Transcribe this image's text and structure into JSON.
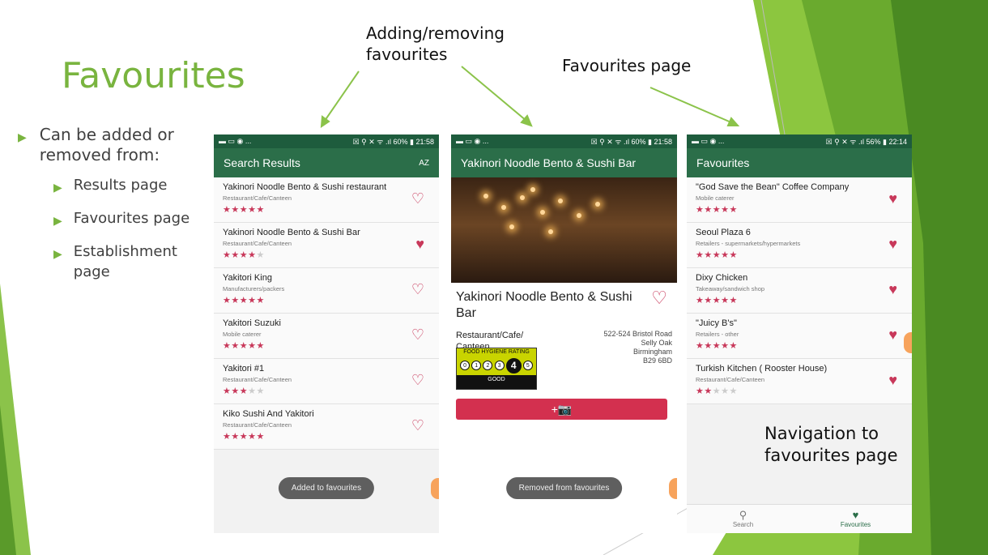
{
  "slide": {
    "title": "Favourites",
    "bullet": "Can be added or removed from:",
    "sub_bullets": [
      "Results page",
      "Favourites page",
      "Establishment page"
    ],
    "callouts": {
      "adding": "Adding/removing favourites",
      "favpage": "Favourites page",
      "nav": "Navigation to favourites page"
    }
  },
  "colors": {
    "accent_green": "#79b43f",
    "app_green": "#2b6e49",
    "heart": "#c8385a"
  },
  "search_screen": {
    "status_left": "▬ ▭ ◉ ...",
    "status_right": "☒ ⚲ ✕ ᯤ .ıl 60% ▮ 21:58",
    "title": "Search Results",
    "sort_icon": "AZ",
    "rows": [
      {
        "name": "Yakinori Noodle Bento & Sushi restaurant",
        "type": "Restaurant/Cafe/Canteen",
        "stars": "★★★★★",
        "stars_off": "",
        "fav": false
      },
      {
        "name": "Yakinori Noodle Bento & Sushi Bar",
        "type": "Restaurant/Cafe/Canteen",
        "stars": "★★★★",
        "stars_off": "★",
        "fav": true
      },
      {
        "name": "Yakitori King",
        "type": "Manufacturers/packers",
        "stars": "★★★★★",
        "stars_off": "",
        "fav": false
      },
      {
        "name": "Yakitori Suzuki",
        "type": "Mobile caterer",
        "stars": "★★★★★",
        "stars_off": "",
        "fav": false
      },
      {
        "name": "Yakitori #1",
        "type": "Restaurant/Cafe/Canteen",
        "stars": "★★★",
        "stars_off": "★★",
        "fav": false
      },
      {
        "name": "Kiko Sushi And Yakitori",
        "type": "Restaurant/Cafe/Canteen",
        "stars": "★★★★★",
        "stars_off": "",
        "fav": false
      }
    ],
    "toast": "Added to favourites"
  },
  "establishment_screen": {
    "status_left": "▬ ▭ ◉ ...",
    "status_right": "☒ ⚲ ✕ ᯤ .ıl 60% ▮ 21:58",
    "title": "Yakinori Noodle Bento & Sushi Bar",
    "name": "Yakinori Noodle Bento & Sushi Bar",
    "type": "Restaurant/Cafe/ Canteen",
    "address": [
      "522-524 Bristol Road",
      "Selly Oak",
      "Birmingham",
      "B29 6BD"
    ],
    "rating": {
      "label": "FOOD HYGIENE RATING",
      "scores": [
        "0",
        "1",
        "2",
        "3",
        "4",
        "5"
      ],
      "value": 4,
      "word": "GOOD"
    },
    "photo_icon": "+📷",
    "toast": "Removed from favourites"
  },
  "favourites_screen": {
    "status_left": "▬ ▭ ◉ ...",
    "status_right": "☒ ⚲ ✕ ᯤ .ıl 56% ▮ 22:14",
    "title": "Favourites",
    "rows": [
      {
        "name": "\"God Save the Bean\" Coffee Company",
        "type": "Mobile caterer",
        "stars": "★★★★★",
        "stars_off": ""
      },
      {
        "name": "Seoul Plaza 6",
        "type": "Retailers - supermarkets/hypermarkets",
        "stars": "★★★★★",
        "stars_off": ""
      },
      {
        "name": "Dixy Chicken",
        "type": "Takeaway/sandwich shop",
        "stars": "★★★★★",
        "stars_off": ""
      },
      {
        "name": "\"Juicy B's\"",
        "type": "Retailers - other",
        "stars": "★★★★★",
        "stars_off": ""
      },
      {
        "name": "Turkish Kitchen ( Rooster House)",
        "type": "Restaurant/Cafe/Canteen",
        "stars": "★★",
        "stars_off": "★★★"
      }
    ],
    "nav": {
      "search": "Search",
      "favourites": "Favourites"
    }
  }
}
